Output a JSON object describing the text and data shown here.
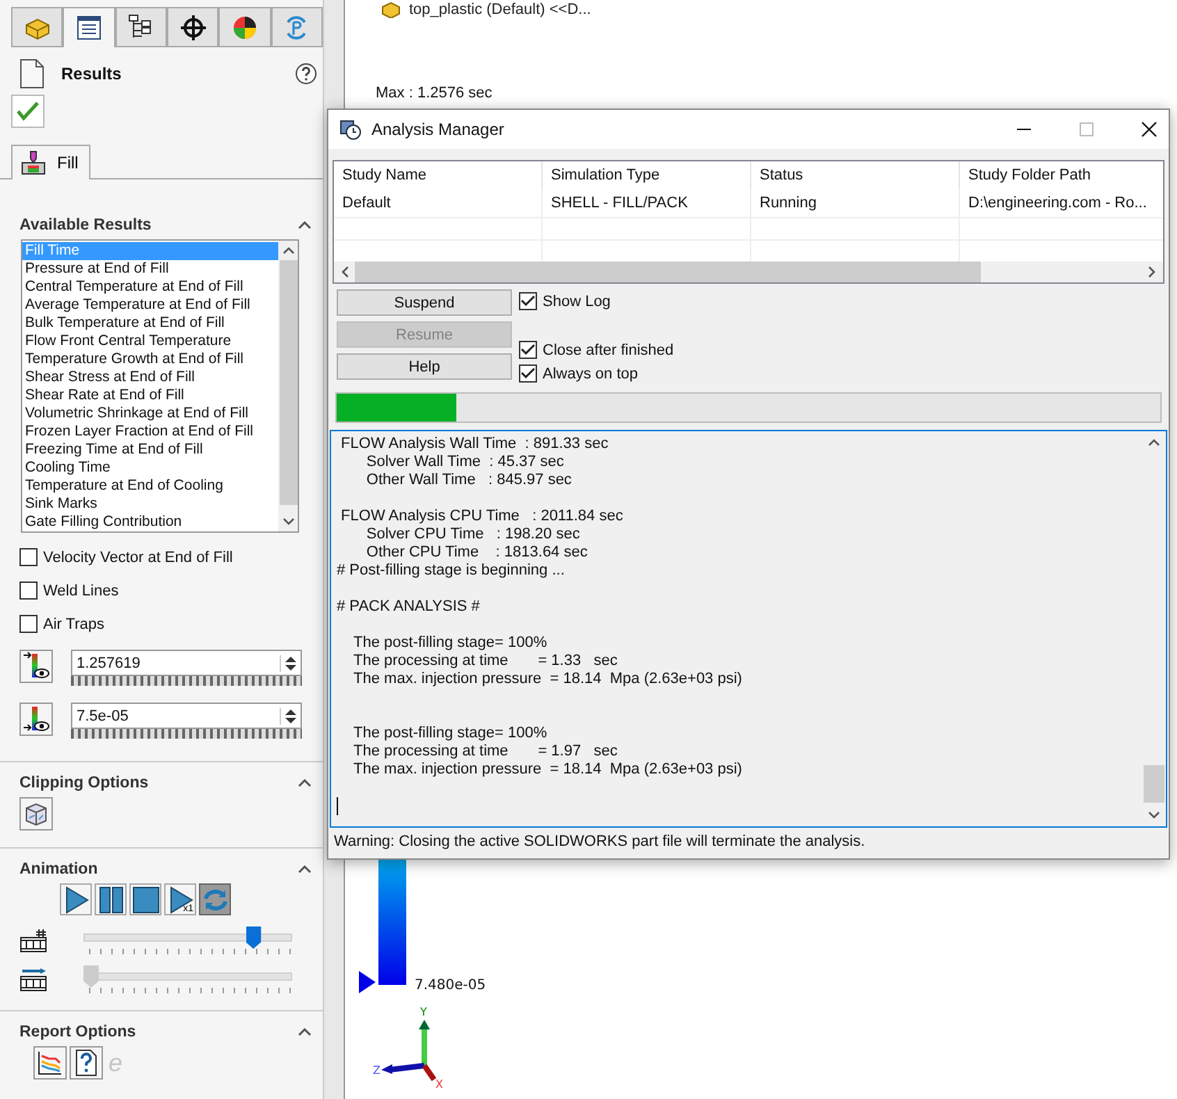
{
  "canvas": {
    "tree_item": "top_plastic (Default) <<D...",
    "max_label": "Max : 1.2576 sec",
    "legend_min": "7.480e-05",
    "axes": {
      "y": "Y",
      "z": "Z",
      "x": "X"
    }
  },
  "left_panel": {
    "tabs": [
      {
        "selected": false
      },
      {
        "selected": true
      },
      {
        "selected": false
      },
      {
        "selected": false
      },
      {
        "selected": false
      },
      {
        "selected": false
      }
    ],
    "title": "Results",
    "sub_tab": {
      "label": "Fill",
      "selected": true
    },
    "available_results": {
      "title": "Available Results",
      "items": [
        {
          "label": "Fill Time",
          "selected": true
        },
        {
          "label": "Pressure at End of Fill",
          "selected": false
        },
        {
          "label": "Central Temperature at End of Fill",
          "selected": false
        },
        {
          "label": "Average Temperature at End of Fill",
          "selected": false
        },
        {
          "label": "Bulk Temperature at End of Fill",
          "selected": false
        },
        {
          "label": "Flow Front Central Temperature",
          "selected": false
        },
        {
          "label": "Temperature Growth at End of Fill",
          "selected": false
        },
        {
          "label": "Shear Stress at End of Fill",
          "selected": false
        },
        {
          "label": "Shear Rate at End of Fill",
          "selected": false
        },
        {
          "label": "Volumetric Shrinkage at End of Fill",
          "selected": false
        },
        {
          "label": "Frozen Layer Fraction at End of Fill",
          "selected": false
        },
        {
          "label": "Freezing Time at End of Fill",
          "selected": false
        },
        {
          "label": "Cooling Time",
          "selected": false
        },
        {
          "label": "Temperature at End of Cooling",
          "selected": false
        },
        {
          "label": "Sink Marks",
          "selected": false
        },
        {
          "label": "Gate Filling Contribution",
          "selected": false
        }
      ],
      "checkboxes": [
        {
          "label": "Velocity Vector at End of Fill",
          "checked": false
        },
        {
          "label": "Weld Lines",
          "checked": false
        },
        {
          "label": "Air Traps",
          "checked": false
        }
      ],
      "ranges": [
        {
          "kind": "max",
          "value": "1.257619"
        },
        {
          "kind": "min",
          "value": "7.5e-05"
        }
      ]
    },
    "clipping": {
      "title": "Clipping Options"
    },
    "animation": {
      "title": "Animation",
      "buttons": [
        {
          "kind": "play",
          "on": false
        },
        {
          "kind": "pause",
          "on": false
        },
        {
          "kind": "stop",
          "on": false
        },
        {
          "kind": "step",
          "on": false,
          "badge": "x1"
        },
        {
          "kind": "loop",
          "on": true
        }
      ],
      "sliders": [
        {
          "kind": "frame",
          "level": 0.81
        },
        {
          "kind": "speed",
          "level": 0.0
        }
      ]
    },
    "report": {
      "title": "Report Options",
      "buttons": [
        {
          "kind": "chart"
        },
        {
          "kind": "help"
        },
        {
          "kind": "glyph",
          "glyph": "e",
          "disabled": true
        }
      ]
    }
  },
  "dialog": {
    "title": "Analysis Manager",
    "table": {
      "columns": [
        "Study Name",
        "Simulation Type",
        "Status",
        "Study Folder Path"
      ],
      "rows": [
        [
          "Default",
          "SHELL - FILL/PACK",
          "Running",
          "D:\\engineering.com - Ro..."
        ]
      ]
    },
    "buttons": [
      {
        "label": "Suspend",
        "disabled": false
      },
      {
        "label": "Resume",
        "disabled": true
      },
      {
        "label": "Help",
        "disabled": false
      }
    ],
    "options": [
      {
        "label": "Show Log",
        "checked": true
      },
      {
        "label": "Close after finished",
        "checked": true
      },
      {
        "label": "Always on top",
        "checked": true
      }
    ],
    "progress": {
      "level": 0.145
    },
    "log": [
      {
        "kind": "text",
        "text": " FLOW Analysis Wall Time  : 891.33 sec"
      },
      {
        "kind": "text",
        "text": "       Solver Wall Time  : 45.37 sec"
      },
      {
        "kind": "text",
        "text": "       Other Wall Time   : 845.97 sec"
      },
      {
        "kind": "blank"
      },
      {
        "kind": "text",
        "text": " FLOW Analysis CPU Time   : 2011.84 sec"
      },
      {
        "kind": "text",
        "text": "       Solver CPU Time   : 198.20 sec"
      },
      {
        "kind": "text",
        "text": "       Other CPU Time    : 1813.64 sec"
      },
      {
        "kind": "text",
        "text": "# Post-filling stage is beginning ..."
      },
      {
        "kind": "blank"
      },
      {
        "kind": "text",
        "text": "# PACK ANALYSIS #"
      },
      {
        "kind": "blank"
      },
      {
        "kind": "text",
        "text": "    The post-filling stage= 100%"
      },
      {
        "kind": "text",
        "text": "    The processing at time       = 1.33   sec"
      },
      {
        "kind": "text",
        "text": "    The max. injection pressure  = 18.14  Mpa (2.63e+03 psi)"
      },
      {
        "kind": "blank"
      },
      {
        "kind": "blank"
      },
      {
        "kind": "text",
        "text": "    The post-filling stage= 100%"
      },
      {
        "kind": "text",
        "text": "    The processing at time       = 1.97   sec"
      },
      {
        "kind": "text",
        "text": "    The max. injection pressure  = 18.14  Mpa (2.63e+03 psi)"
      },
      {
        "kind": "blank"
      },
      {
        "kind": "cursor"
      }
    ],
    "warning": "Warning: Closing the active SOLIDWORKS part file will terminate the analysis."
  }
}
